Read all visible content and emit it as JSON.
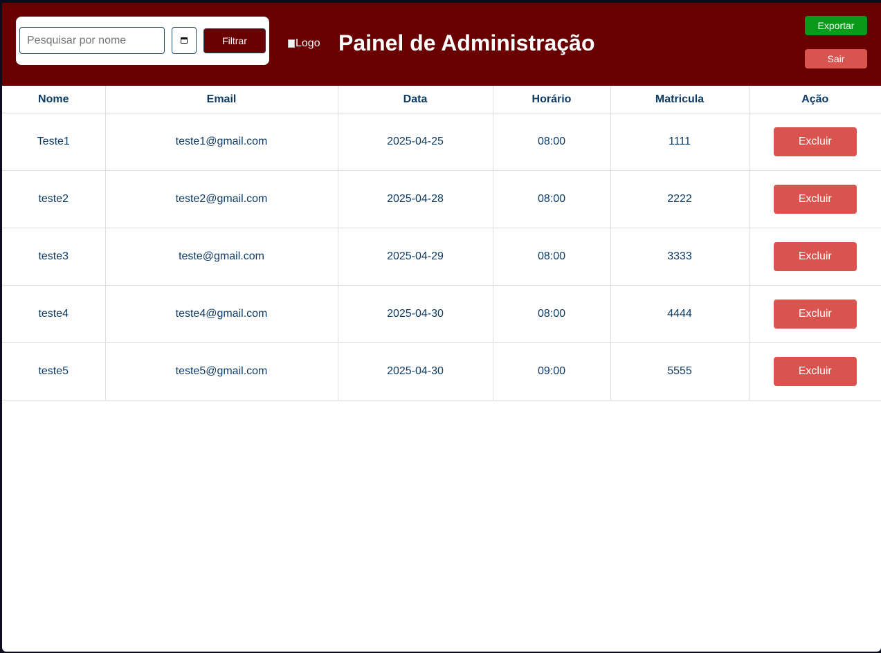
{
  "header": {
    "search_placeholder": "Pesquisar por nome",
    "filter_label": "Filtrar",
    "logo_alt": "Logo",
    "title": "Painel de Administração",
    "export_label": "Exportar",
    "logout_label": "Sair"
  },
  "table": {
    "columns": [
      "Nome",
      "Email",
      "Data",
      "Horário",
      "Matricula",
      "Ação"
    ],
    "delete_label": "Excluir",
    "rows": [
      {
        "nome": "Teste1",
        "email": "teste1@gmail.com",
        "data": "2025-04-25",
        "horario": "08:00",
        "matricula": "1111"
      },
      {
        "nome": "teste2",
        "email": "teste2@gmail.com",
        "data": "2025-04-28",
        "horario": "08:00",
        "matricula": "2222"
      },
      {
        "nome": "teste3",
        "email": "teste@gmail.com",
        "data": "2025-04-29",
        "horario": "08:00",
        "matricula": "3333"
      },
      {
        "nome": "teste4",
        "email": "teste4@gmail.com",
        "data": "2025-04-30",
        "horario": "08:00",
        "matricula": "4444"
      },
      {
        "nome": "teste5",
        "email": "teste5@gmail.com",
        "data": "2025-04-30",
        "horario": "09:00",
        "matricula": "5555"
      }
    ]
  },
  "colors": {
    "header_bg": "#680000",
    "export_green": "#0a9a1a",
    "danger_red": "#d9534f",
    "text_blue": "#0d3b66"
  },
  "icons": {
    "date_picker": "calendar-icon",
    "logo": "broken-image-icon"
  }
}
